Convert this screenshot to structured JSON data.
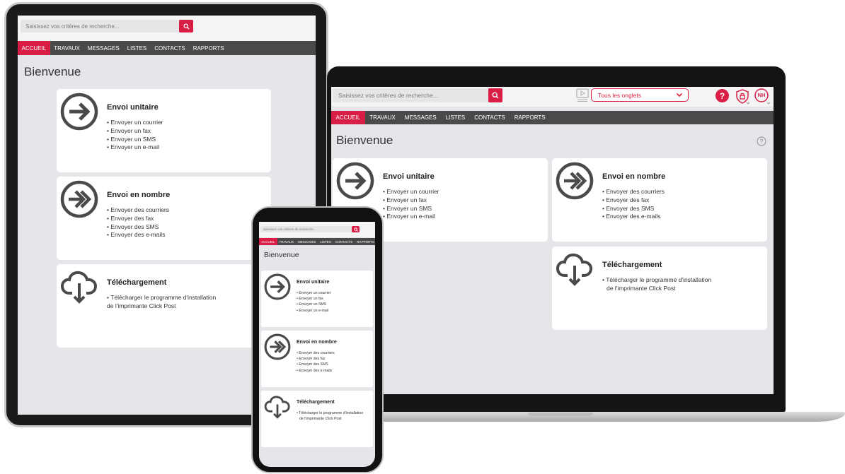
{
  "app": {
    "search_placeholder": "Saisissez vos critères de recherche...",
    "nav_tabs": [
      "ACCUEIL",
      "TRAVAUX",
      "MESSAGES",
      "LISTES",
      "CONTACTS",
      "RAPPORTS"
    ],
    "active_tab": "ACCUEIL",
    "title": "Bienvenue",
    "tabs_selector": "Tous les onglets",
    "help_label": "?",
    "avatar_initials": "NH",
    "accent_color": "#d81e45",
    "nav_color": "#4a4a4a"
  },
  "cards": {
    "unitaire": {
      "title": "Envoi unitaire",
      "icon": "arrow-circle-icon",
      "items": [
        "Envoyer un courrier",
        "Envoyer un fax",
        "Envoyer un SMS",
        "Envoyer un e-mail"
      ]
    },
    "nombre": {
      "title": "Envoi en nombre",
      "icon": "double-arrow-circle-icon",
      "items": [
        "Envoyer des courriers",
        "Envoyer des fax",
        "Envoyer des SMS",
        "Envoyer des e-mails"
      ]
    },
    "telechargement": {
      "title": "Téléchargement",
      "icon": "cloud-download-icon",
      "items": [
        "Télécharger le programme d'installation",
        "de l'imprimante Click Post"
      ]
    }
  }
}
